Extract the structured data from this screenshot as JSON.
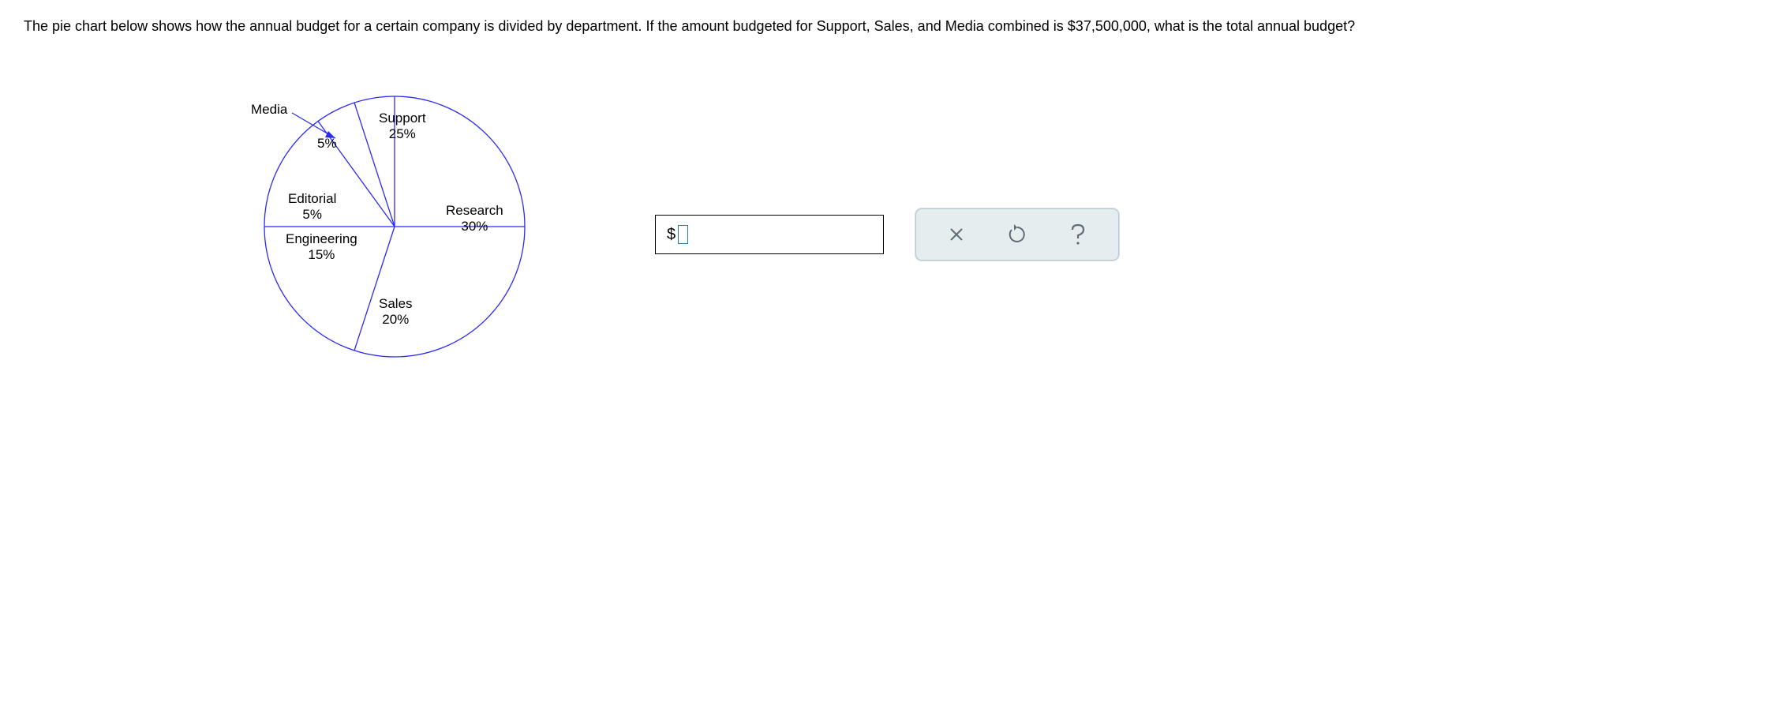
{
  "question": {
    "text_prefix": "The pie chart below shows how the annual budget for a certain company is divided by department. If the amount budgeted for Support, Sales, and Media combined is ",
    "amount": "$37,500,000",
    "text_suffix": ", what is the total annual budget?"
  },
  "chart_data": {
    "type": "pie",
    "title": "",
    "series": [
      {
        "name": "Support",
        "value": 25,
        "label": "Support",
        "pct_label": "25%"
      },
      {
        "name": "Research",
        "value": 30,
        "label": "Research",
        "pct_label": "30%"
      },
      {
        "name": "Sales",
        "value": 20,
        "label": "Sales",
        "pct_label": "20%"
      },
      {
        "name": "Engineering",
        "value": 15,
        "label": "Engineering",
        "pct_label": "15%"
      },
      {
        "name": "Editorial",
        "value": 5,
        "label": "Editorial",
        "pct_label": "5%"
      },
      {
        "name": "Media",
        "value": 5,
        "label": "Media",
        "pct_label": "5%"
      }
    ]
  },
  "answer": {
    "prefix": "$",
    "value": ""
  },
  "toolbar": {
    "close_label": "Close",
    "undo_label": "Undo",
    "help_label": "Help"
  }
}
